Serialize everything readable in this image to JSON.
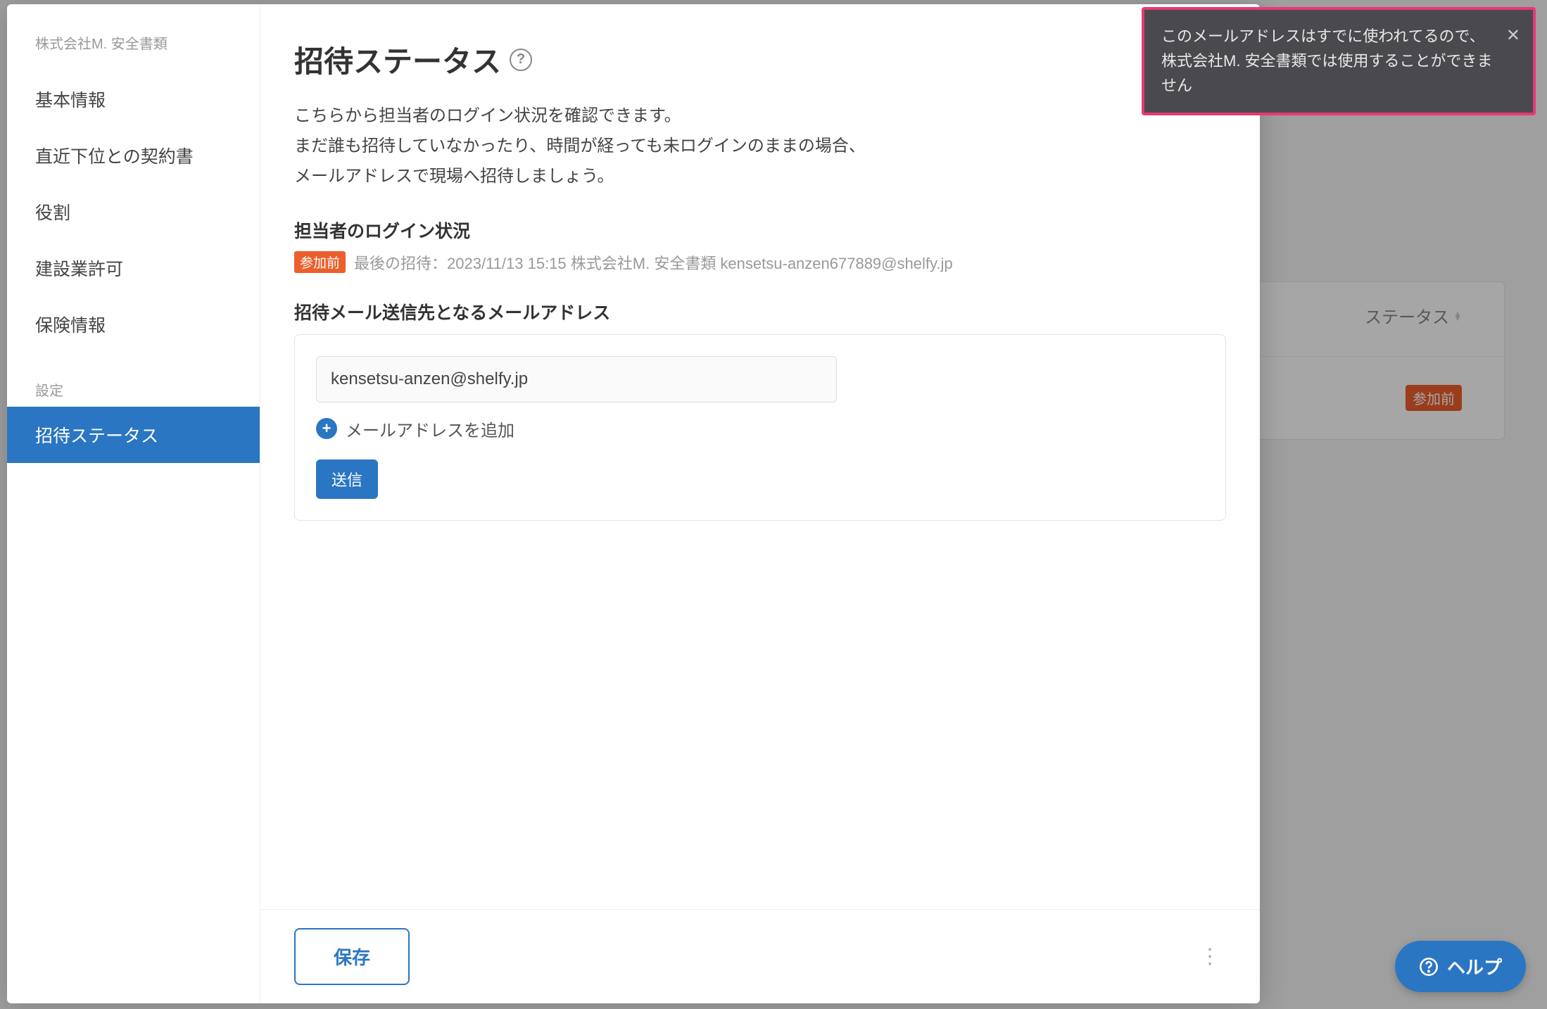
{
  "sidebar": {
    "org_name": "株式会社M. 安全書類",
    "items": [
      {
        "label": "基本情報"
      },
      {
        "label": "直近下位との契約書"
      },
      {
        "label": "役割"
      },
      {
        "label": "建設業許可"
      },
      {
        "label": "保険情報"
      }
    ],
    "settings_section": "設定",
    "settings_items": [
      {
        "label": "招待ステータス",
        "active": true
      }
    ]
  },
  "main": {
    "title": "招待ステータス",
    "help_icon_glyph": "?",
    "description_lines": [
      "こちらから担当者のログイン状況を確認できます。",
      "まだ誰も招待していなかったり、時間が経っても未ログインのままの場合、",
      "メールアドレスで現場へ招待しましょう。"
    ],
    "login_status_heading": "担当者のログイン状況",
    "status_badge": "参加前",
    "last_invite_text": "最後の招待：2023/11/13 15:15 株式会社M. 安全書類 kensetsu-anzen677889@shelfy.jp",
    "email_heading": "招待メール送信先となるメールアドレス",
    "email_value": "kensetsu-anzen@shelfy.jp",
    "add_email_label": "メールアドレスを追加",
    "send_button": "送信",
    "save_button": "保存"
  },
  "toast": {
    "message": "このメールアドレスはすでに使われてるので、株式会社M. 安全書類では使用することができません"
  },
  "help_fab": {
    "label": "ヘルプ"
  },
  "background": {
    "status_column": "ステータス",
    "row_badge": "参加前"
  }
}
